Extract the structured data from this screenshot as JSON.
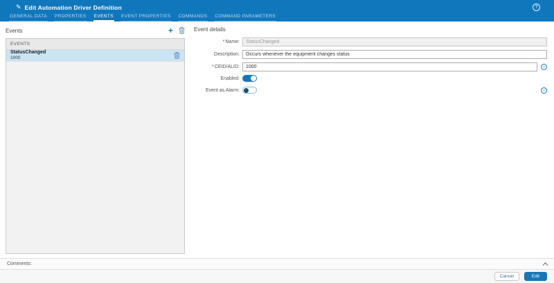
{
  "header": {
    "title": "Edit Automation Driver Definition",
    "tabs": [
      "GENERAL DATA",
      "PROPERTIES",
      "EVENTS",
      "EVENT PROPERTIES",
      "COMMANDS",
      "COMMAND PARAMETERS"
    ],
    "active_tab": "EVENTS",
    "help_icon": "?"
  },
  "events_panel": {
    "title": "Events",
    "add_icon": "+",
    "table_header": "EVENTS",
    "rows": [
      {
        "name": "StatusChanged",
        "id": "1000",
        "selected": true
      }
    ]
  },
  "details": {
    "title": "Event details",
    "required_marker": "*",
    "name_label": "Name:",
    "name_value": "StatusChanged",
    "name_disabled": true,
    "description_label": "Description:",
    "description_value": "Occurs whenever the equipment changes status",
    "ceid_label": "CEID/ALID:",
    "ceid_value": "1000",
    "enabled_label": "Enabled:",
    "enabled_state": "on",
    "alarm_label": "Event as Alarm:",
    "alarm_state": "off",
    "info_icon": "i"
  },
  "comments": {
    "label": "Comments:"
  },
  "footer": {
    "cancel_label": "Cancel",
    "edit_label": "Edit"
  },
  "colors": {
    "primary": "#1177bd",
    "selection": "#cae4f4",
    "toggle_on": "#1177bd",
    "required": "#c9252c"
  }
}
